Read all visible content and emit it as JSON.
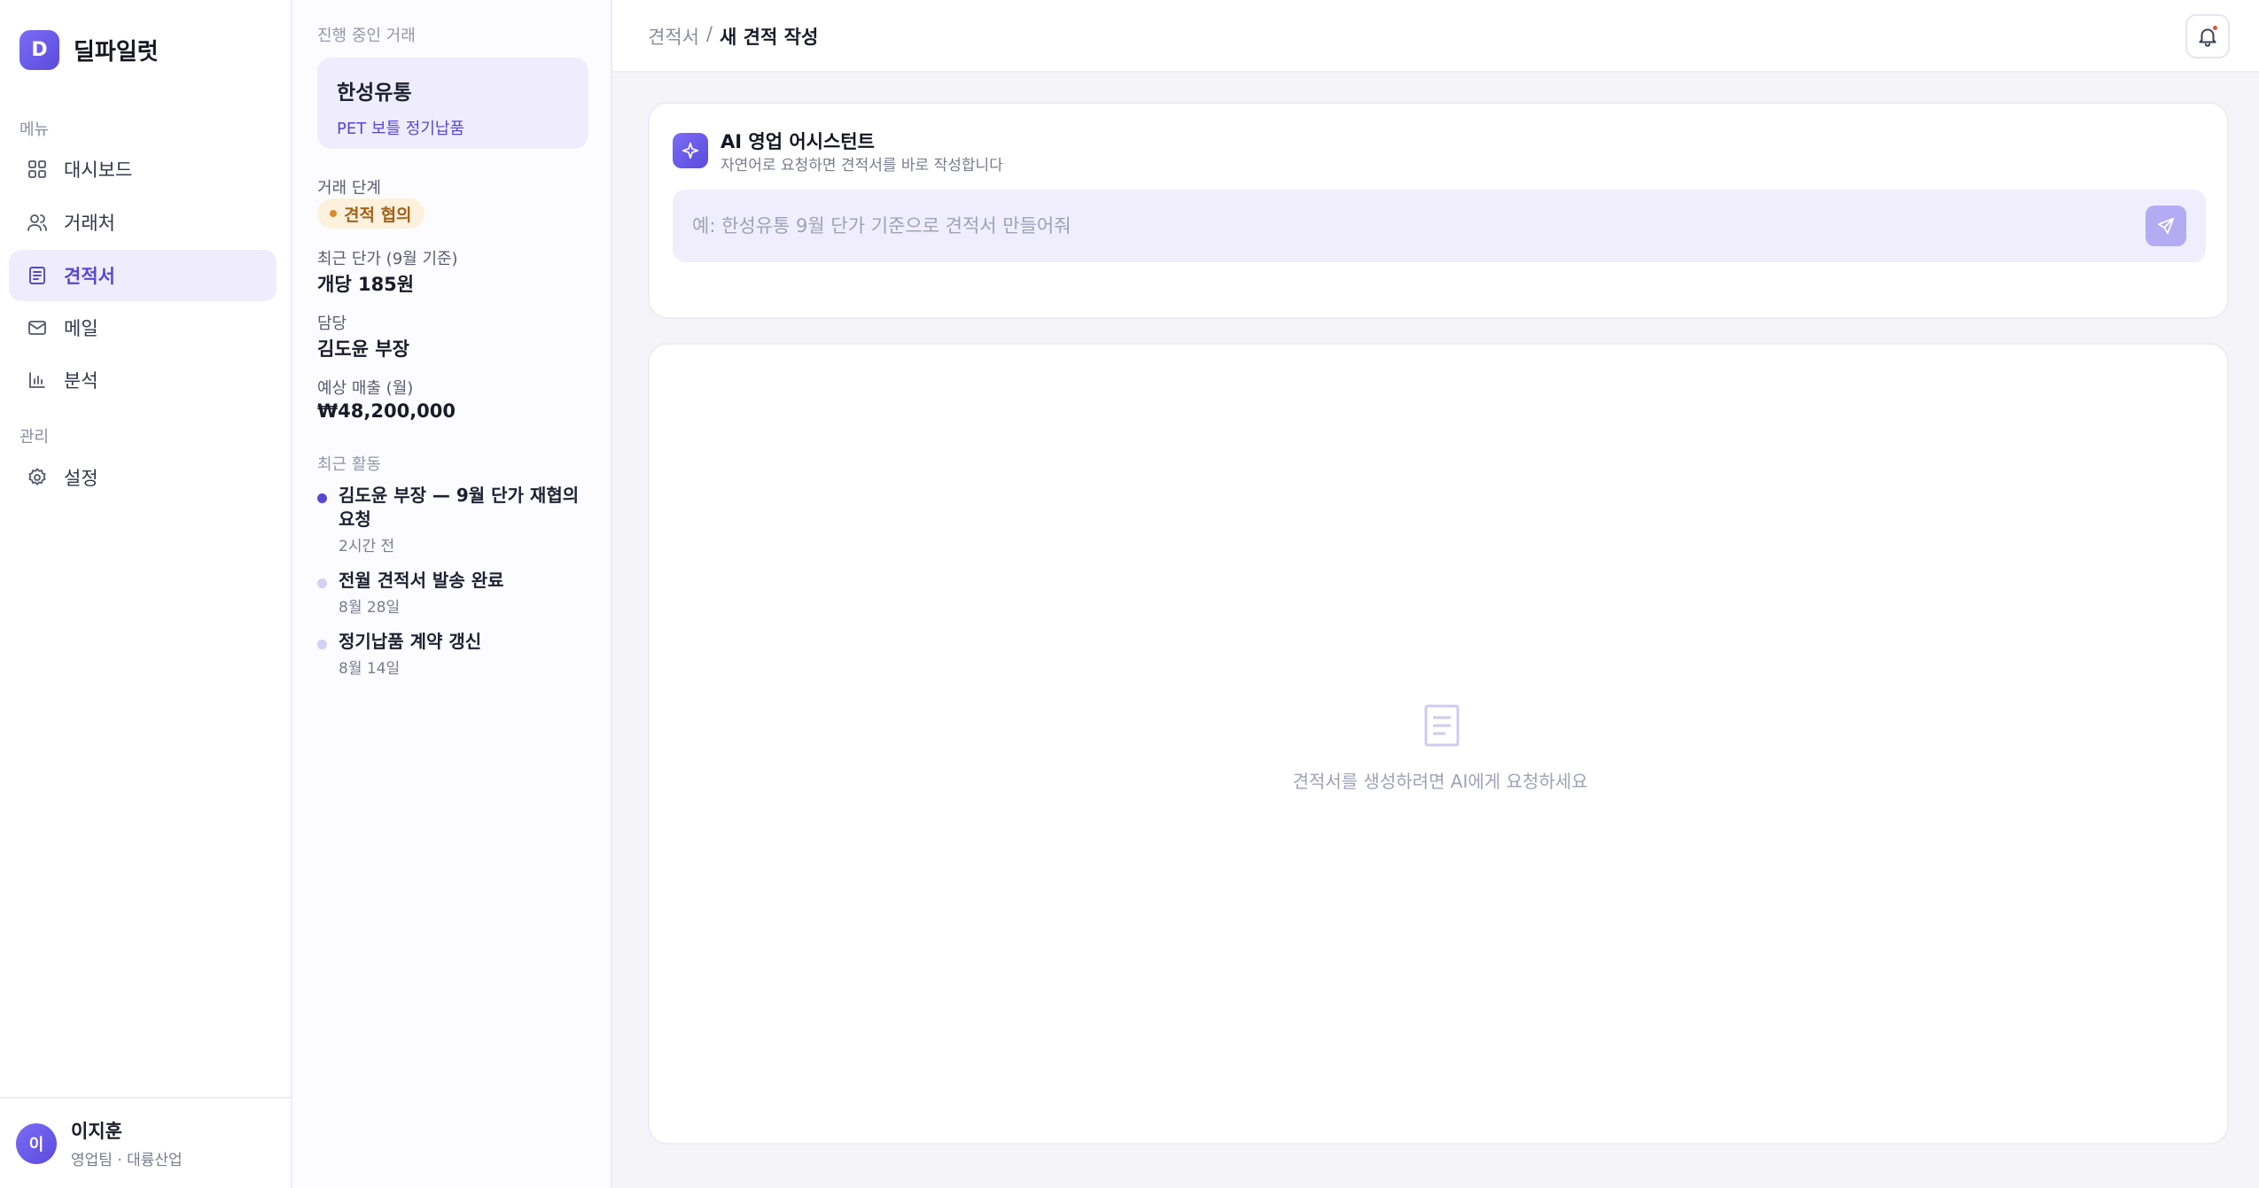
{
  "brand": {
    "logo_letter": "D",
    "name": "딜파일럿"
  },
  "sidebar": {
    "menu_label": "메뉴",
    "items": [
      {
        "label": "대시보드",
        "icon": "grid-icon"
      },
      {
        "label": "거래처",
        "icon": "users-icon"
      },
      {
        "label": "견적서",
        "icon": "document-icon",
        "active": true
      },
      {
        "label": "메일",
        "icon": "mail-icon"
      },
      {
        "label": "분석",
        "icon": "bar-chart-icon"
      }
    ],
    "admin_label": "관리",
    "admin_items": [
      {
        "label": "설정",
        "icon": "gear-icon"
      }
    ]
  },
  "user": {
    "initial": "이",
    "name": "이지훈",
    "team": "영업팀 · 대륭산업"
  },
  "deal_panel": {
    "heading": "진행 중인 거래",
    "deal": {
      "name": "한성유통",
      "product": "PET 보틀 정기납품"
    },
    "stage": {
      "label": "거래 단계",
      "value": "견적 협의"
    },
    "recent_price": {
      "label": "최근 단가 (9월 기준)",
      "value": "개당 185원"
    },
    "owner": {
      "label": "담당",
      "value": "김도윤 부장"
    },
    "expected_revenue": {
      "label": "예상 매출 (월)",
      "value": "₩48,200,000"
    },
    "activity_heading": "최근 활동",
    "activities": [
      {
        "title": "김도윤 부장 — 9월 단가 재협의 요청",
        "time": "2시간 전"
      },
      {
        "title": "전월 견적서 발송 완료",
        "time": "8월 28일"
      },
      {
        "title": "정기납품 계약 갱신",
        "time": "8월 14일"
      }
    ]
  },
  "topbar": {
    "breadcrumb_parent": "견적서",
    "breadcrumb_sep": "/",
    "breadcrumb_current": "새 견적 작성"
  },
  "assistant": {
    "title": "AI 영업 어시스턴트",
    "subtitle": "자연어로 요청하면 견적서를 바로 작성합니다",
    "placeholder": "예: 한성유통 9월 단가 기준으로 견적서 만들어줘",
    "value": ""
  },
  "empty_state": {
    "message": "견적서를 생성하려면 AI에게 요청하세요"
  },
  "colors": {
    "accent": "#5646d6",
    "accent_soft": "#efedfd",
    "stage_badge_bg": "#fdf1dd",
    "stage_badge_text": "#a0621b",
    "notification_dot": "#e2523c"
  }
}
